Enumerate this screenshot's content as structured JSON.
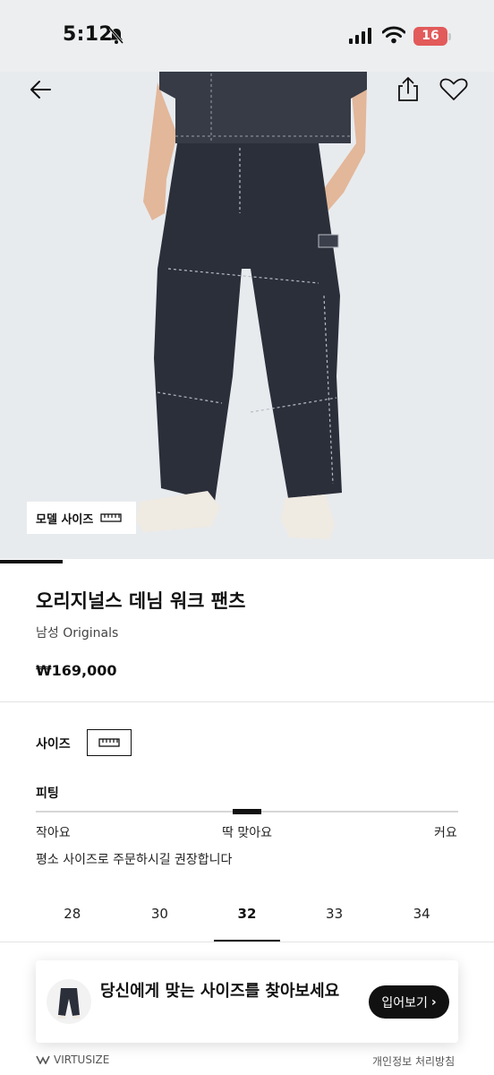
{
  "status_bar": {
    "time": "5:12",
    "battery": "16"
  },
  "header": {
    "back_icon": "arrow-left-icon",
    "share_icon": "share-icon",
    "wishlist_icon": "heart-icon"
  },
  "hero": {
    "model_size_label": "모델 사이즈",
    "ruler_icon": "ruler-icon"
  },
  "product": {
    "title": "오리지널스 데님 워크 팬츠",
    "subtitle": "남성 Originals",
    "price": "₩169,000"
  },
  "size_section": {
    "label": "사이즈",
    "fit_label": "피팅",
    "fit_small": "작아요",
    "fit_true": "딱 맞아요",
    "fit_large": "커요",
    "fit_position": 0.5,
    "fit_note": "평소 사이즈로 주문하시길 권장합니다",
    "sizes": [
      "28",
      "30",
      "32",
      "33",
      "34"
    ],
    "selected_size": "32"
  },
  "virtusize": {
    "message": "당신에게 맞는 사이즈를 찾아보세요",
    "button_label": "입어보기",
    "brand": "VIRTUSIZE",
    "privacy": "개인정보 처리방침"
  },
  "colors": {
    "accent": "#111111",
    "battery": "#e25a5a",
    "hero_bg": "#e8ebee",
    "denim": "#2b2f3a"
  }
}
